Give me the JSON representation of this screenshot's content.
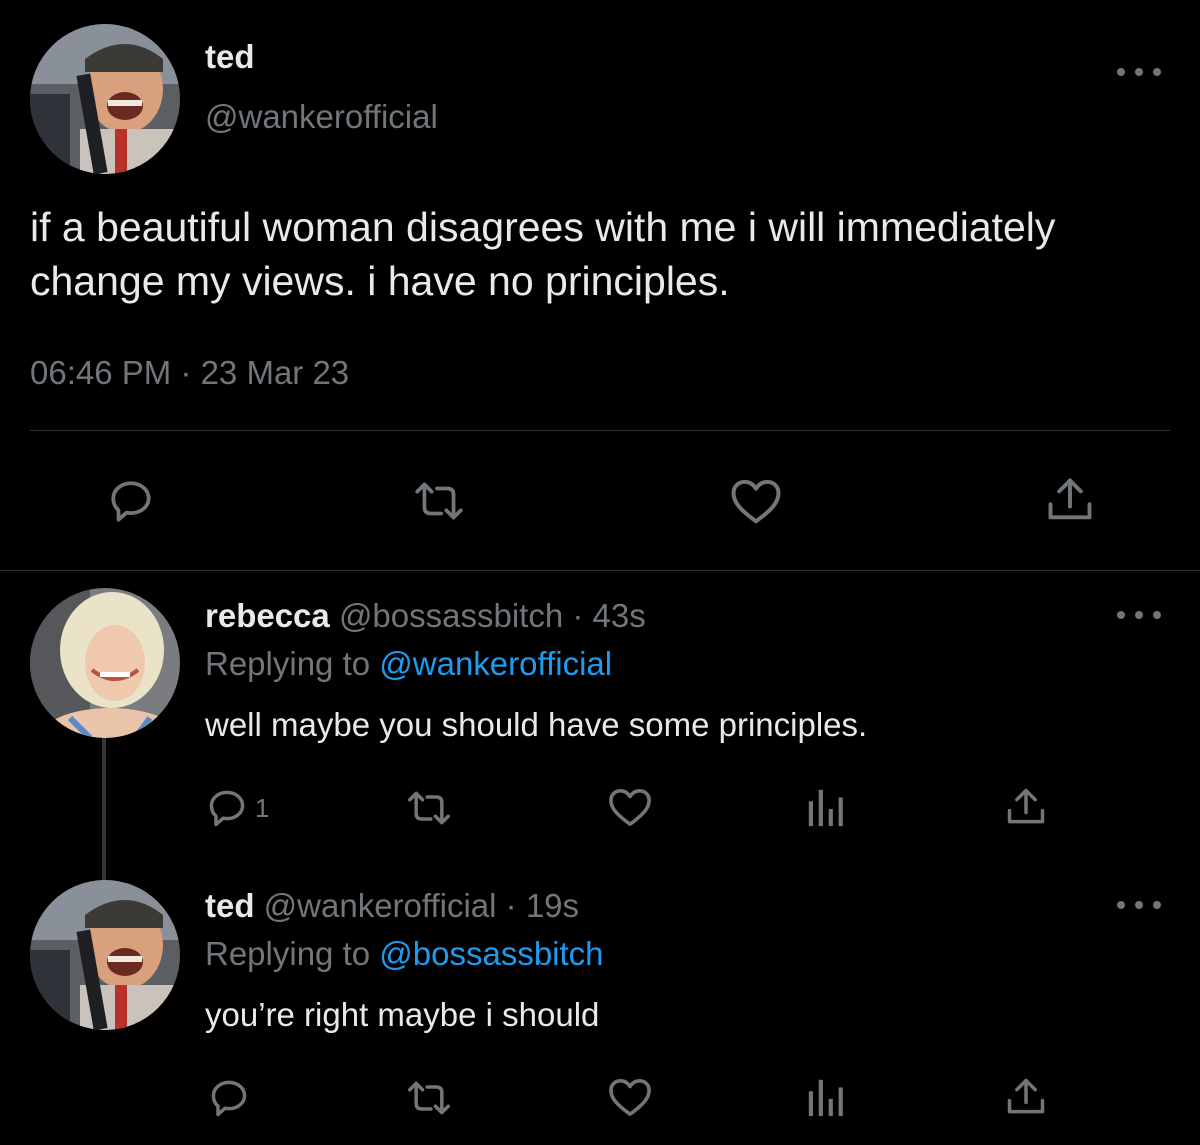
{
  "main_tweet": {
    "name": "ted",
    "handle": "@wankerofficial",
    "text": "if a beautiful woman disagrees with me i will immediately change my views. i have no principles.",
    "time": "06:46 PM · 23 Mar 23",
    "actions": [
      "reply-icon",
      "retweet-icon",
      "like-icon",
      "share-icon"
    ]
  },
  "replies": [
    {
      "name": "rebecca",
      "handle": "@bossassbitch",
      "sep": " · ",
      "time": "43s",
      "replying_prefix": "Replying to ",
      "replying_to": "@wankerofficial",
      "text": "well maybe you should have some principles.",
      "reply_count": "1",
      "actions": [
        "reply-icon",
        "retweet-icon",
        "like-icon",
        "views-icon",
        "share-icon"
      ]
    },
    {
      "name": "ted",
      "handle": "@wankerofficial",
      "sep": " · ",
      "time": "19s",
      "replying_prefix": "Replying to ",
      "replying_to": "@bossassbitch",
      "text": "you’re right maybe i should",
      "actions": [
        "reply-icon",
        "retweet-icon",
        "like-icon",
        "views-icon",
        "share-icon"
      ]
    }
  ],
  "colors": {
    "background": "#000000",
    "primary_text": "#e7e9ea",
    "secondary_text": "#71767b",
    "accent": "#1d9bf0",
    "divider": "#2f3336"
  }
}
